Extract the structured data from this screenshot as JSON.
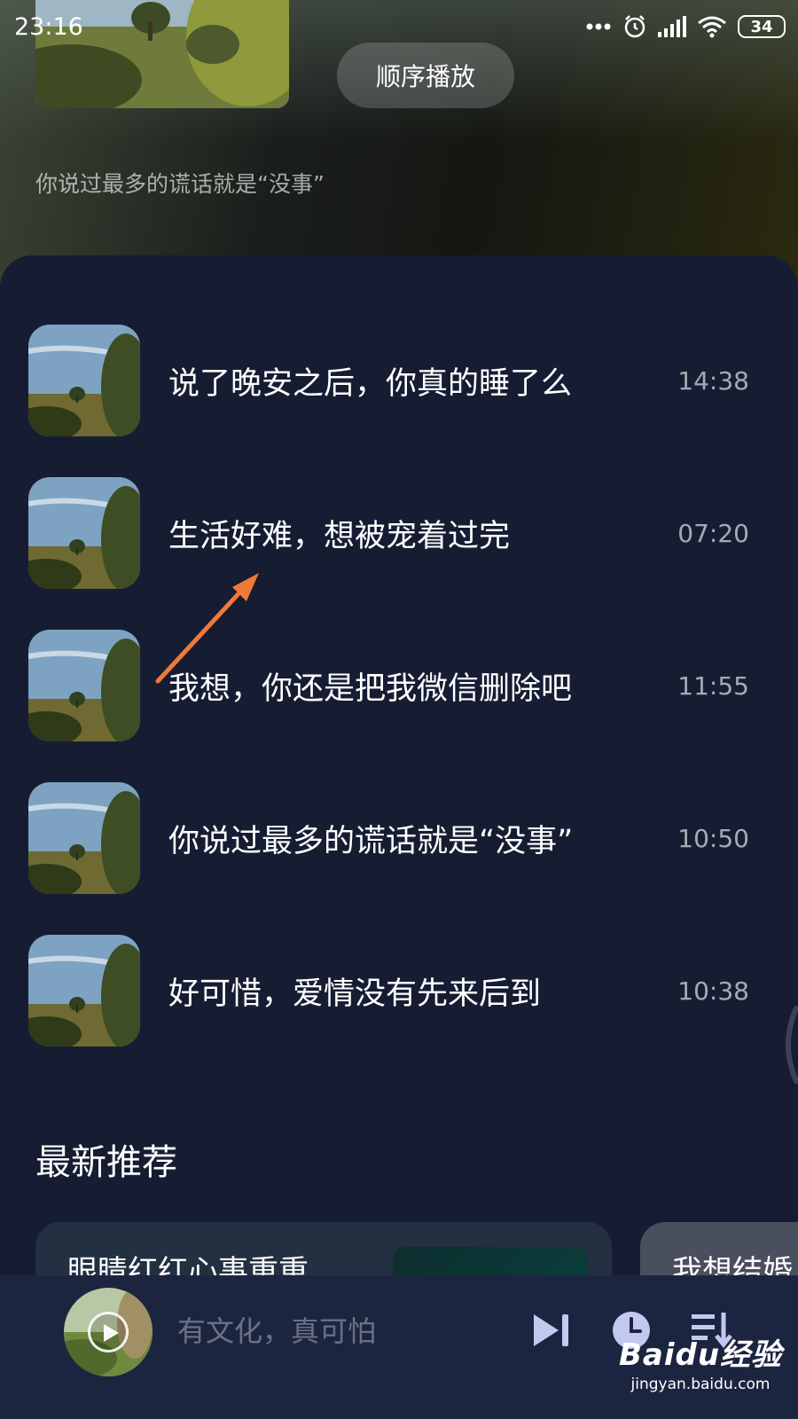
{
  "status_bar": {
    "time": "23:16",
    "battery": "34"
  },
  "header": {
    "play_order_label": "顺序播放",
    "subtitle": "你说过最多的谎话就是“没事”"
  },
  "tracks": [
    {
      "title": "说了晚安之后，你真的睡了么",
      "time": "14:38"
    },
    {
      "title": "生活好难，想被宠着过完",
      "time": "07:20"
    },
    {
      "title": "我想，你还是把我微信删除吧",
      "time": "11:55"
    },
    {
      "title": "你说过最多的谎话就是“没事”",
      "time": "10:50"
    },
    {
      "title": "好可惜，爱情没有先来后到",
      "time": "10:38"
    }
  ],
  "recommendations": {
    "section_title": "最新推荐",
    "cards": [
      {
        "title": "眼睛红红心事重重"
      },
      {
        "title": "我想结婚"
      }
    ]
  },
  "mini_player": {
    "title": "有文化，真可怕"
  },
  "watermark": {
    "logo": "Baidu经验",
    "url": "jingyan.baidu.com"
  },
  "colors": {
    "background": "#161d33",
    "player_bar": "#1c2540",
    "annotation_arrow": "#f0793a",
    "icon_lavender": "#c3c8ef"
  },
  "icons": [
    "dots-icon",
    "alarm-icon",
    "signal-icon",
    "wifi-icon",
    "battery-icon",
    "play-icon",
    "skip-next-icon",
    "timer-icon",
    "playlist-icon"
  ]
}
